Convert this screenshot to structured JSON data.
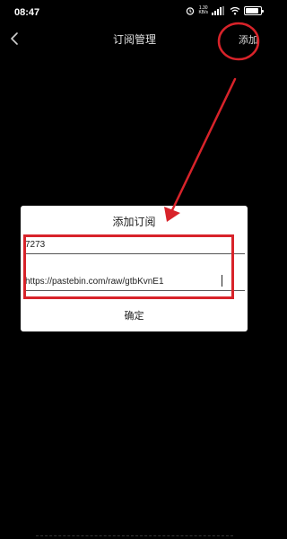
{
  "status_bar": {
    "time": "08:47",
    "net_speed_value": "1.30",
    "net_speed_unit": "KB/s",
    "battery_level_percent": 90,
    "icons": [
      "alarm-icon",
      "signal-icon",
      "wifi-icon",
      "battery-icon"
    ]
  },
  "header": {
    "title": "订阅管理",
    "add_label": "添加",
    "back_icon": "chevron-left-icon"
  },
  "dialog": {
    "title": "添加订阅",
    "name_value": "7273",
    "url_value": "https://pastebin.com/raw/gtbKvnE1",
    "confirm_label": "确定"
  },
  "annotation": {
    "color": "#d8232a",
    "marks": [
      "circle-around-add-button",
      "arrow-to-dialog",
      "box-around-input-fields"
    ]
  },
  "colors": {
    "background": "#000000",
    "dialog_background": "#ffffff",
    "annotation_red": "#d8232a"
  }
}
